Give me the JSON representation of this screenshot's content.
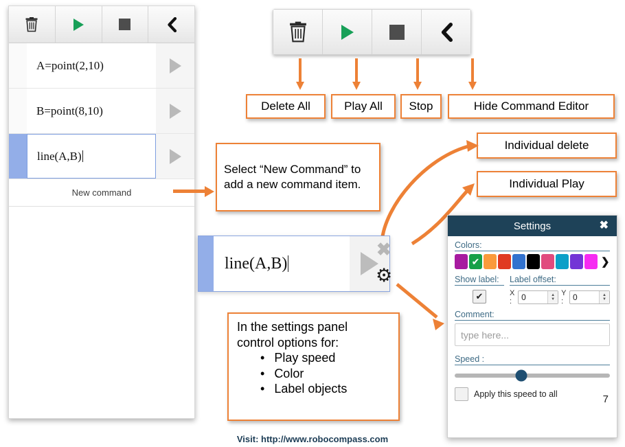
{
  "command_panel": {
    "toolbar": [
      {
        "name": "delete-all",
        "icon": "trash-icon"
      },
      {
        "name": "play-all",
        "icon": "play-icon"
      },
      {
        "name": "stop",
        "icon": "stop-icon"
      },
      {
        "name": "hide-command-editor",
        "icon": "chevron-left-icon"
      }
    ],
    "rows": [
      {
        "text": "A=point(2,10)",
        "selected": false,
        "caret": false
      },
      {
        "text": "B=point(8,10)",
        "selected": false,
        "caret": false
      },
      {
        "text": "line(A,B)",
        "selected": true,
        "caret": true
      }
    ],
    "new_command_label": "New command"
  },
  "big_toolbar": {
    "buttons": [
      {
        "name": "delete-all",
        "icon": "trash-icon"
      },
      {
        "name": "play-all",
        "icon": "play-icon"
      },
      {
        "name": "stop",
        "icon": "stop-icon"
      },
      {
        "name": "hide-command-editor",
        "icon": "chevron-left-icon"
      }
    ]
  },
  "callouts": {
    "delete_all": "Delete All",
    "play_all": "Play All",
    "stop": "Stop",
    "hide_command_editor": "Hide Command Editor",
    "new_command": "Select “New Command” to add a new command item.",
    "individual_delete": "Individual delete",
    "individual_play": "Individual Play",
    "settings_panel_line1": "In the settings panel",
    "settings_panel_line2": "control options for:",
    "settings_panel_bullets": [
      "Play speed",
      "Color",
      "Label objects"
    ]
  },
  "big_command": {
    "text": "line(A,B)",
    "delete_icon": "close-icon",
    "settings_icon": "gear-icon",
    "play_icon": "play-icon"
  },
  "settings": {
    "title": "Settings",
    "close_icon": "close-icon",
    "colors_label": "Colors:",
    "swatches": [
      {
        "hex": "#a71ba0",
        "selected": false
      },
      {
        "hex": "#17a048",
        "selected": true
      },
      {
        "hex": "#fa9a3c",
        "selected": false
      },
      {
        "hex": "#e03a22",
        "selected": false
      },
      {
        "hex": "#3272ce",
        "selected": false
      },
      {
        "hex": "#000000",
        "selected": false
      },
      {
        "hex": "#e14b7e",
        "selected": false
      },
      {
        "hex": "#0ba0c8",
        "selected": false
      },
      {
        "hex": "#7335d6",
        "selected": false
      },
      {
        "hex": "#f62bf2",
        "selected": false
      }
    ],
    "more_colors_icon": "chevron-right-icon",
    "show_label_label": "Show label:",
    "show_label_checked": "✔",
    "label_offset_label": "Label offset:",
    "offset_x_label": "X :",
    "offset_x_value": "0",
    "offset_y_label": "Y :",
    "offset_y_value": "0",
    "comment_label": "Comment:",
    "comment_placeholder": "type here...",
    "comment_value": "",
    "speed_label": "Speed :",
    "speed_percent": 43,
    "apply_speed_label": "Apply this speed to all",
    "apply_speed_checked": false,
    "page_number": "7",
    "header_color": "#1e4258",
    "accent_color": "#ed8136"
  },
  "footer": {
    "text": "Visit:  http://www.robocompass.com"
  }
}
